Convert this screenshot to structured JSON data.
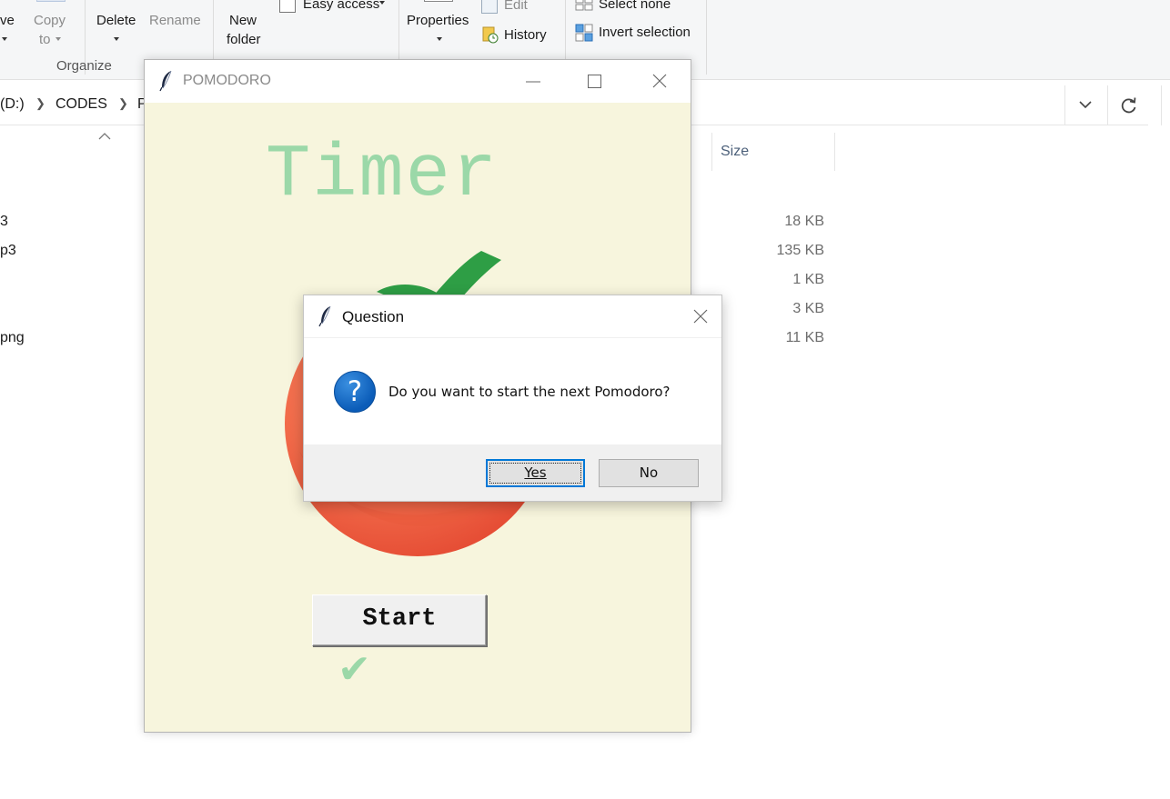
{
  "explorer": {
    "ribbon": {
      "move_label": "ve",
      "copy_to_line1": "Copy",
      "copy_to_line2": "to",
      "delete_label": "Delete",
      "rename_label": "Rename",
      "new_folder_line1": "New",
      "new_folder_line2": "folder",
      "easy_access_label": "Easy access",
      "properties_label": "Properties",
      "edit_label": "Edit",
      "history_label": "History",
      "select_none_label": "Select none",
      "invert_selection_label": "Invert selection",
      "organize_group_label": "Organize"
    },
    "address": {
      "drive_label": "(D:)",
      "folder_label": "CODES",
      "next_label": "P"
    },
    "columns": {
      "size_label": "Size"
    },
    "files": [
      {
        "name": "3",
        "size": "18 KB"
      },
      {
        "name": "p3",
        "size": "135 KB"
      },
      {
        "name": "",
        "size": "1 KB"
      },
      {
        "name": "",
        "size": "3 KB"
      },
      {
        "name": "png",
        "size": "11 KB"
      }
    ]
  },
  "pomodoro": {
    "window_title": "POMODORO",
    "timer_label": "Timer",
    "start_button": "Start",
    "checkmarks": "✔"
  },
  "dialog": {
    "title": "Question",
    "message": "Do you want to start the next Pomodoro?",
    "yes_label": "Yes",
    "no_label": "No"
  },
  "colors": {
    "timer_green": "#9bd8a8",
    "pomodoro_bg": "#f7f5dd",
    "tomato": "#f26b4a",
    "leaf_green": "#2e9e45",
    "accent_blue": "#0078d7"
  }
}
